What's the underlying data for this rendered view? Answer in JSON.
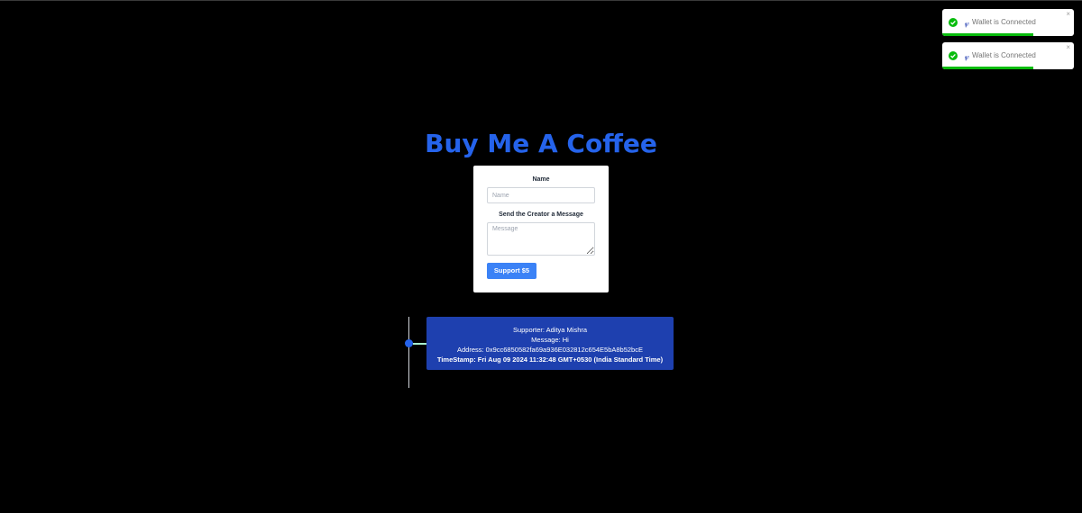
{
  "toasts": [
    {
      "message": "Wallet is Connected",
      "close": "×",
      "progress": 0.69
    },
    {
      "message": "Wallet is Connected",
      "close": "×",
      "progress": 0.69
    }
  ],
  "title": "Buy Me A Coffee",
  "form": {
    "name_label": "Name",
    "name_placeholder": "Name",
    "message_label": "Send the Creator a Message",
    "message_placeholder": "Message",
    "submit_label": "Support $5"
  },
  "memo": {
    "supporter": "Supporter: Aditya Mishra",
    "message": "Message: Hi",
    "address": "Address: 0x9cc6850582fa69a936E032812c654E5bA8b52bcE",
    "timestamp": "TimeStamp: Fri Aug 09 2024 11:32:48 GMT+0530 (India Standard Time)"
  },
  "colors": {
    "background": "#000000",
    "title": "#2563eb",
    "button": "#3b82f6",
    "memo_card": "#1e40af",
    "toast_success": "#07bc0c"
  }
}
